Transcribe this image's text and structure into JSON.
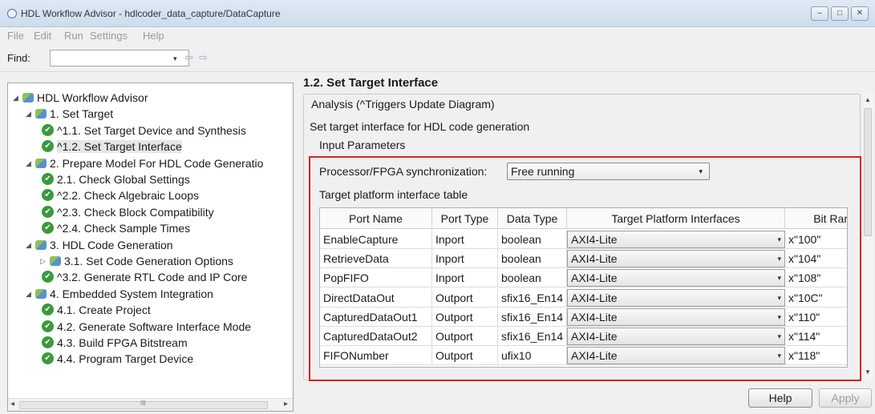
{
  "window": {
    "title": "HDL Workflow Advisor - hdlcoder_data_capture/DataCapture",
    "controls": [
      "–",
      "□",
      "✕"
    ]
  },
  "menu": [
    "File",
    "Edit",
    "Run",
    "Settings",
    "Help"
  ],
  "find": {
    "label": "Find:",
    "value": "",
    "dropdown_glyph": "▾",
    "prev_glyph": "⇦",
    "next_glyph": "⇨"
  },
  "tree": {
    "items": [
      {
        "label": "HDL Workflow Advisor",
        "level": 0,
        "icon": "folder-icon",
        "expander": "◢"
      },
      {
        "label": "1. Set Target",
        "level": 1,
        "icon": "folder-icon",
        "expander": "◢"
      },
      {
        "label": "^1.1. Set Target Device and Synthesis",
        "level": 2,
        "icon": "check-icon"
      },
      {
        "label": "^1.2. Set Target Interface",
        "level": 2,
        "icon": "check-icon",
        "selected": true
      },
      {
        "label": "2. Prepare Model For HDL Code Generatio",
        "level": 1,
        "icon": "folder-icon",
        "expander": "◢"
      },
      {
        "label": "2.1. Check Global Settings",
        "level": 2,
        "icon": "check-icon"
      },
      {
        "label": "^2.2. Check Algebraic Loops",
        "level": 2,
        "icon": "check-icon"
      },
      {
        "label": "^2.3. Check Block Compatibility",
        "level": 2,
        "icon": "check-icon"
      },
      {
        "label": "^2.4. Check Sample Times",
        "level": 2,
        "icon": "check-icon"
      },
      {
        "label": "3. HDL Code Generation",
        "level": 1,
        "icon": "folder-icon",
        "expander": "◢"
      },
      {
        "label": "3.1. Set Code Generation Options",
        "level": 2,
        "icon": "folder-icon",
        "expander": "▷"
      },
      {
        "label": "^3.2. Generate RTL Code and IP Core",
        "level": 2,
        "icon": "check-icon"
      },
      {
        "label": "4. Embedded System Integration",
        "level": 1,
        "icon": "folder-icon",
        "expander": "◢"
      },
      {
        "label": "4.1. Create Project",
        "level": 2,
        "icon": "check-icon"
      },
      {
        "label": "4.2. Generate Software Interface Mode",
        "level": 2,
        "icon": "check-icon"
      },
      {
        "label": "4.3. Build FPGA Bitstream",
        "level": 2,
        "icon": "check-icon"
      },
      {
        "label": "4.4. Program Target Device",
        "level": 2,
        "icon": "check-icon"
      }
    ],
    "scroll_left": "◂",
    "scroll_right": "▸",
    "scroll_grip": "III"
  },
  "task": {
    "title": "1.2. Set Target Interface",
    "analysis": "Analysis (^Triggers Update Diagram)",
    "description": "Set target interface for HDL code generation",
    "input_params": "Input Parameters",
    "sync_label": "Processor/FPGA synchronization:",
    "sync_value": "Free running",
    "table_label": "Target platform interface table",
    "columns": [
      "Port Name",
      "Port Type",
      "Data Type",
      "Target Platform Interfaces",
      "Bit Rar"
    ],
    "rows": [
      {
        "port": "EnableCapture",
        "type": "Inport",
        "dtype": "boolean",
        "iface": "AXI4-Lite",
        "bits": "x\"100\""
      },
      {
        "port": "RetrieveData",
        "type": "Inport",
        "dtype": "boolean",
        "iface": "AXI4-Lite",
        "bits": "x\"104\""
      },
      {
        "port": "PopFIFO",
        "type": "Inport",
        "dtype": "boolean",
        "iface": "AXI4-Lite",
        "bits": "x\"108\""
      },
      {
        "port": "DirectDataOut",
        "type": "Outport",
        "dtype": "sfix16_En14",
        "iface": "AXI4-Lite",
        "bits": "x\"10C\""
      },
      {
        "port": "CapturedDataOut1",
        "type": "Outport",
        "dtype": "sfix16_En14",
        "iface": "AXI4-Lite",
        "bits": "x\"110\""
      },
      {
        "port": "CapturedDataOut2",
        "type": "Outport",
        "dtype": "sfix16_En14",
        "iface": "AXI4-Lite",
        "bits": "x\"114\""
      },
      {
        "port": "FIFONumber",
        "type": "Outport",
        "dtype": "ufix10",
        "iface": "AXI4-Lite",
        "bits": "x\"118\""
      }
    ],
    "dropdown_glyph": "▾"
  },
  "buttons": {
    "help": "Help",
    "apply": "Apply"
  },
  "colors": {
    "highlight_border": "#e02020",
    "check_green": "#3a9a3a"
  }
}
